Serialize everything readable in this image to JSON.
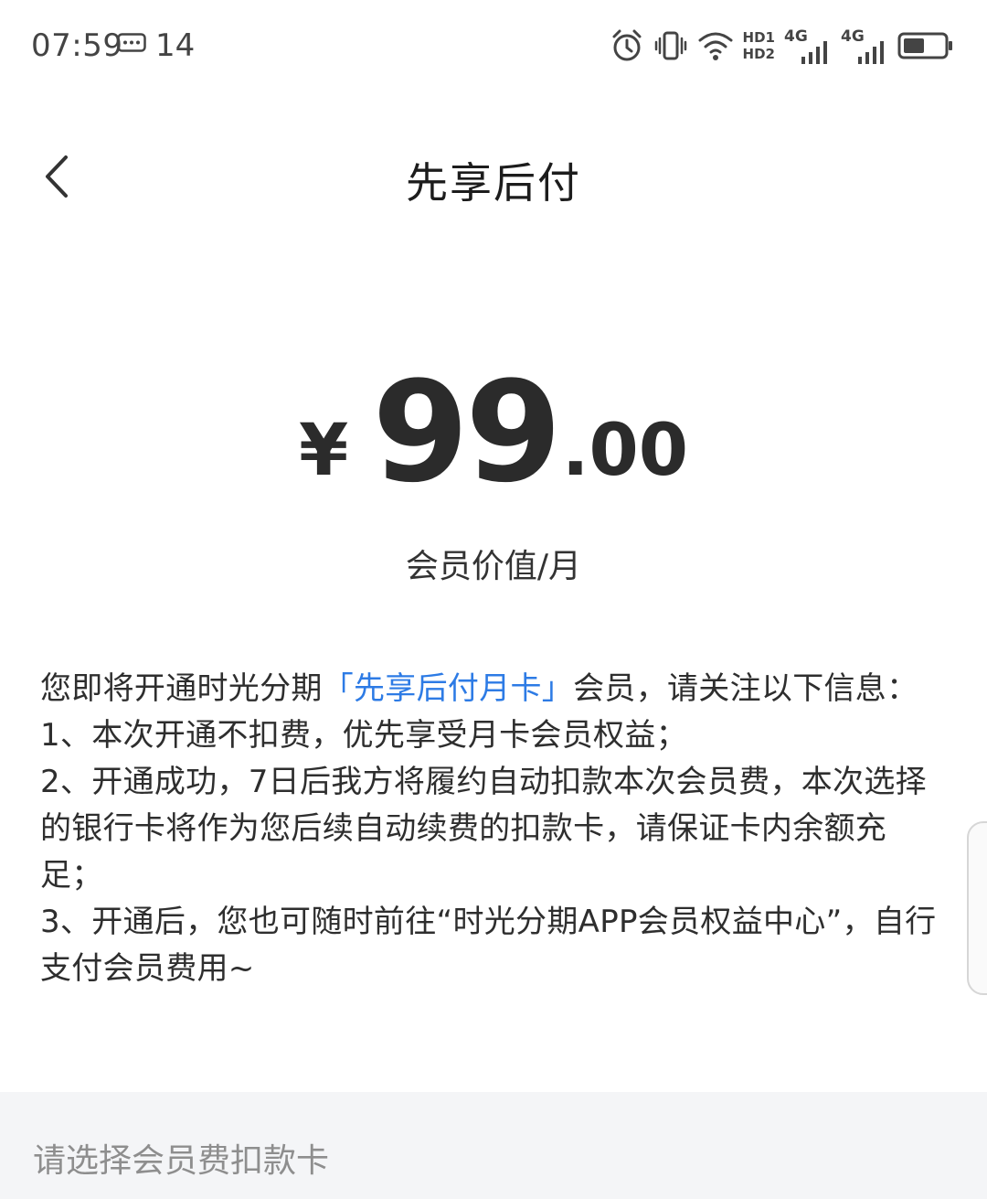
{
  "status_bar": {
    "time": "07:59",
    "notification_count": "14",
    "hd1": "HD1",
    "hd2": "HD2",
    "net1": "4G",
    "net2": "4G",
    "icons": [
      "message-icon",
      "alarm-icon",
      "vibrate-icon",
      "wifi-icon",
      "signal-icon",
      "battery-icon"
    ]
  },
  "header": {
    "title": "先享后付",
    "back_icon": "chevron-left-icon"
  },
  "price": {
    "currency": "¥",
    "integer": "99",
    "decimal": ".00",
    "caption": "会员价值/月"
  },
  "info": {
    "intro_before": "您即将开通时光分期",
    "intro_highlight": "「先享后付月卡」",
    "intro_after": "会员，请关注以下信息：",
    "item1": "1、本次开通不扣费，优先享受月卡会员权益；",
    "item2": "2、开通成功，7日后我方将履约自动扣款本次会员费，本次选择的银行卡将作为您后续自动续费的扣款卡，请保证卡内余额充足；",
    "item3": "3、开通后，您也可随时前往“时光分期APP会员权益中心”，自行支付会员费用~"
  },
  "card_select": {
    "placeholder": "请选择会员费扣款卡"
  },
  "colors": {
    "accent": "#2d7be5",
    "text": "#2e2e2e",
    "muted": "#8e8e8e",
    "section_bg": "#f4f5f7"
  }
}
